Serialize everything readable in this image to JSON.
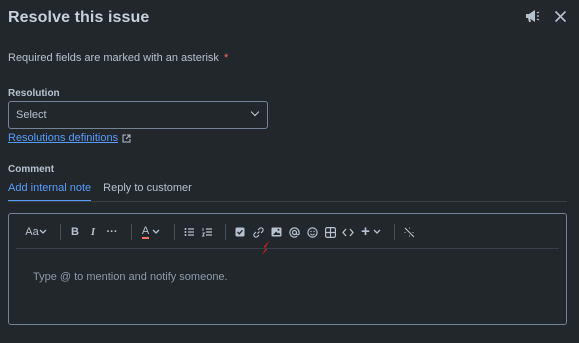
{
  "dialog": {
    "title": "Resolve this issue",
    "required_note": "Required fields are marked with an asterisk",
    "required_asterisk": "*"
  },
  "header_icons": [
    "megaphone-icon",
    "close-icon"
  ],
  "resolution": {
    "label": "Resolution",
    "select_value": "Select",
    "definitions_link": "Resolutions definitions"
  },
  "comment": {
    "label": "Comment",
    "tabs": [
      {
        "label": "Add internal note",
        "active": true
      },
      {
        "label": "Reply to customer",
        "active": false
      }
    ],
    "toolbar": {
      "text_style": "Aa",
      "bold": "B",
      "italic": "I",
      "more": "···",
      "text_color": "A",
      "insert": "+"
    },
    "placeholder": "Type @ to mention and notify someone."
  },
  "colors": {
    "background": "#22272b",
    "accent": "#579dff",
    "asterisk": "#f87168",
    "annotation_arrow": "#e0201a"
  }
}
